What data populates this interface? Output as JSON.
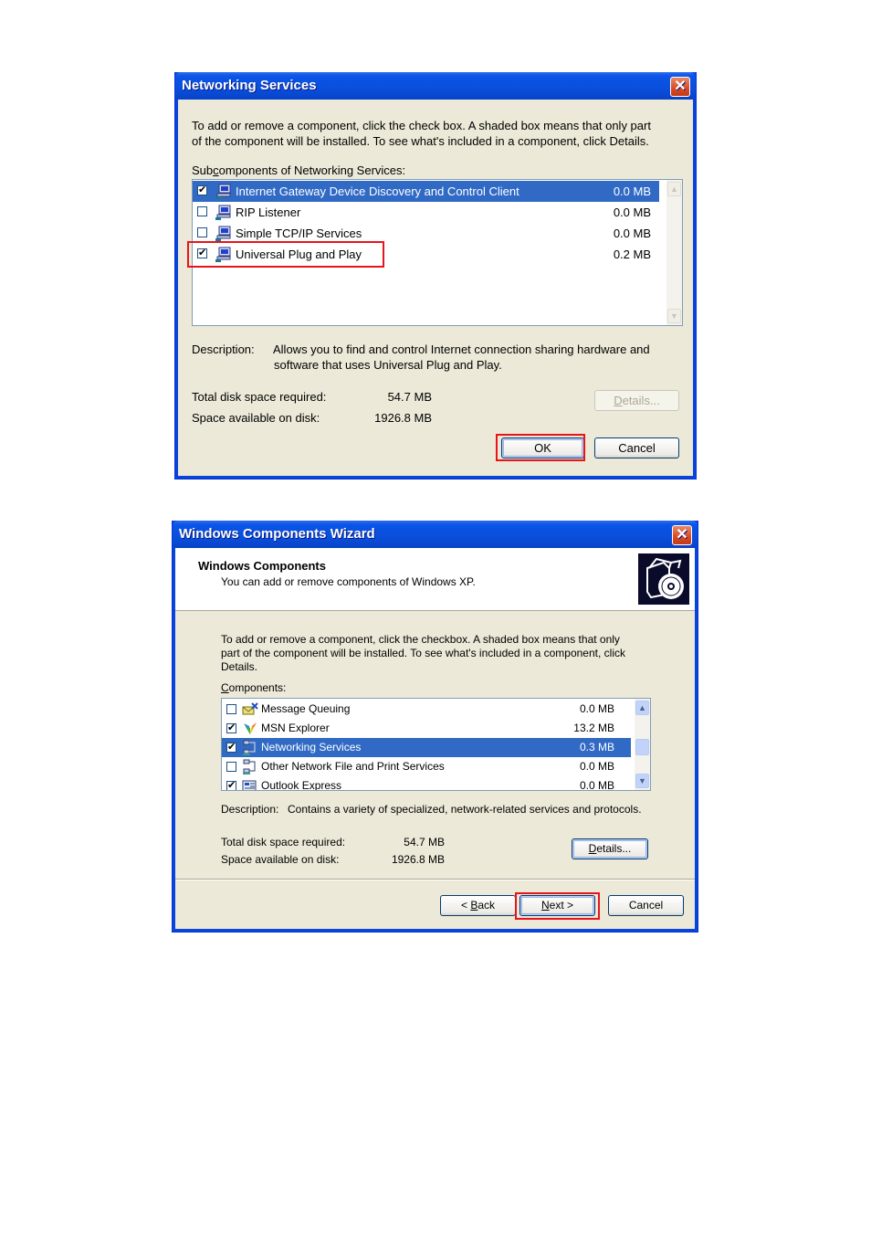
{
  "colors": {
    "title_bar": "#0a4fdc",
    "dialog_face": "#ece9d8",
    "selection": "#316ac5",
    "highlight_box": "#e8141c",
    "close_button": "#d94a24"
  },
  "networking_dialog": {
    "title": "Networking Services",
    "close_icon": "close-icon",
    "instructions_line1": "To add or remove a component, click the check box. A shaded box means that only part",
    "instructions_line2": "of the component will be installed. To see what's included in a component, click Details.",
    "list_label_pre": "Sub",
    "list_label_accel": "c",
    "list_label_post": "omponents of Networking Services:",
    "items": [
      {
        "label": "Internet Gateway Device Discovery and Control Client",
        "size": "0.0 MB",
        "checked": true,
        "selected": true,
        "icon": "network-computer-icon"
      },
      {
        "label": "RIP Listener",
        "size": "0.0 MB",
        "checked": false,
        "selected": false,
        "icon": "network-computer-icon"
      },
      {
        "label": "Simple TCP/IP Services",
        "size": "0.0 MB",
        "checked": false,
        "selected": false,
        "icon": "network-computer-icon"
      },
      {
        "label": "Universal Plug and Play",
        "size": "0.2 MB",
        "checked": true,
        "selected": false,
        "icon": "network-computer-icon",
        "highlighted": true
      }
    ],
    "description_label": "Description:",
    "description_line1": "Allows you to find and control Internet connection sharing hardware and",
    "description_line2": "software that uses Universal Plug and Play.",
    "total_disk_label": "Total disk space required:",
    "total_disk_value": "54.7 MB",
    "space_available_label": "Space available on disk:",
    "space_available_value": "1926.8 MB",
    "details_accel": "D",
    "details_rest": "etails...",
    "details_enabled": false,
    "ok_label": "OK",
    "cancel_label": "Cancel"
  },
  "wizard_dialog": {
    "title": "Windows Components Wizard",
    "header_title": "Windows Components",
    "header_subtitle": "You can add or remove components of Windows XP.",
    "header_icon": "box-cd-icon",
    "instructions_line1": "To add or remove a component, click the checkbox.  A shaded box means that only",
    "instructions_line2": "part of the component will be installed.  To see what's included in a component, click",
    "instructions_line3": "Details.",
    "list_label_accel": "C",
    "list_label_post": "omponents:",
    "items": [
      {
        "label": "Message Queuing",
        "size": "0.0 MB",
        "checked": false,
        "selected": false,
        "icon": "message-queuing-icon"
      },
      {
        "label": "MSN Explorer",
        "size": "13.2 MB",
        "checked": true,
        "selected": false,
        "icon": "msn-butterfly-icon"
      },
      {
        "label": "Networking Services",
        "size": "0.3 MB",
        "checked": true,
        "selected": true,
        "icon": "network-services-icon"
      },
      {
        "label": "Other Network File and Print Services",
        "size": "0.0 MB",
        "checked": false,
        "selected": false,
        "icon": "network-services-icon"
      },
      {
        "label": "Outlook Express",
        "size": "0.0 MB",
        "checked": true,
        "selected": false,
        "icon": "outlook-express-icon"
      }
    ],
    "description_label": "Description:",
    "description_text": "Contains a variety of specialized, network-related services and protocols.",
    "total_disk_label": "Total disk space required:",
    "total_disk_value": "54.7 MB",
    "space_available_label": "Space available on disk:",
    "space_available_value": "1926.8 MB",
    "details_accel": "D",
    "details_rest": "etails...",
    "back_pre": "< ",
    "back_accel": "B",
    "back_rest": "ack",
    "next_accel": "N",
    "next_rest": "ext >",
    "cancel_label": "Cancel"
  }
}
